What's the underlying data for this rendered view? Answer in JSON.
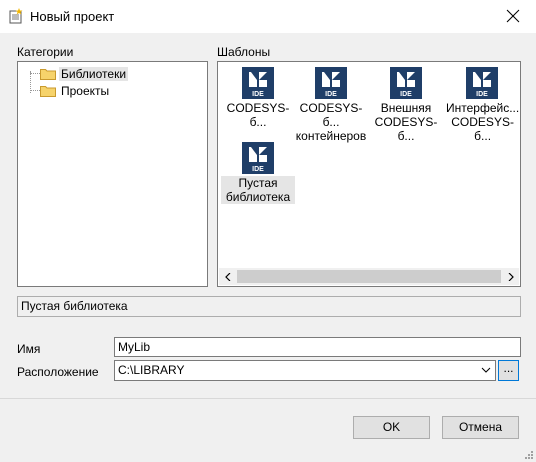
{
  "window": {
    "title": "Новый проект"
  },
  "categories": {
    "label": "Категории",
    "items": [
      {
        "label": "Библиотеки"
      },
      {
        "label": "Проекты"
      }
    ]
  },
  "templates": {
    "label": "Шаблоны",
    "items": [
      {
        "label": "CODESYS-б...",
        "icon": "codesys-ide-icon"
      },
      {
        "label": "CODESYS-б... контейнеров",
        "icon": "codesys-ide-icon"
      },
      {
        "label": "Внешняя CODESYS-б...",
        "icon": "codesys-ide-icon"
      },
      {
        "label": "Интерфейс... CODESYS-б...",
        "icon": "codesys-ide-icon"
      },
      {
        "label": "Пустая библиотека",
        "icon": "codesys-ide-icon"
      }
    ],
    "icon_text": "IDE"
  },
  "description": "Пустая библиотека",
  "form": {
    "name_label": "Имя",
    "name_value": "MyLib",
    "location_label": "Расположение",
    "location_value": "C:\\LIBRARY",
    "browse_label": "..."
  },
  "buttons": {
    "ok": "OK",
    "cancel": "Отмена"
  },
  "colors": {
    "icon_bg": "#1f3e68",
    "selection": "#e5e5e5",
    "focus_border": "#0078d7"
  }
}
